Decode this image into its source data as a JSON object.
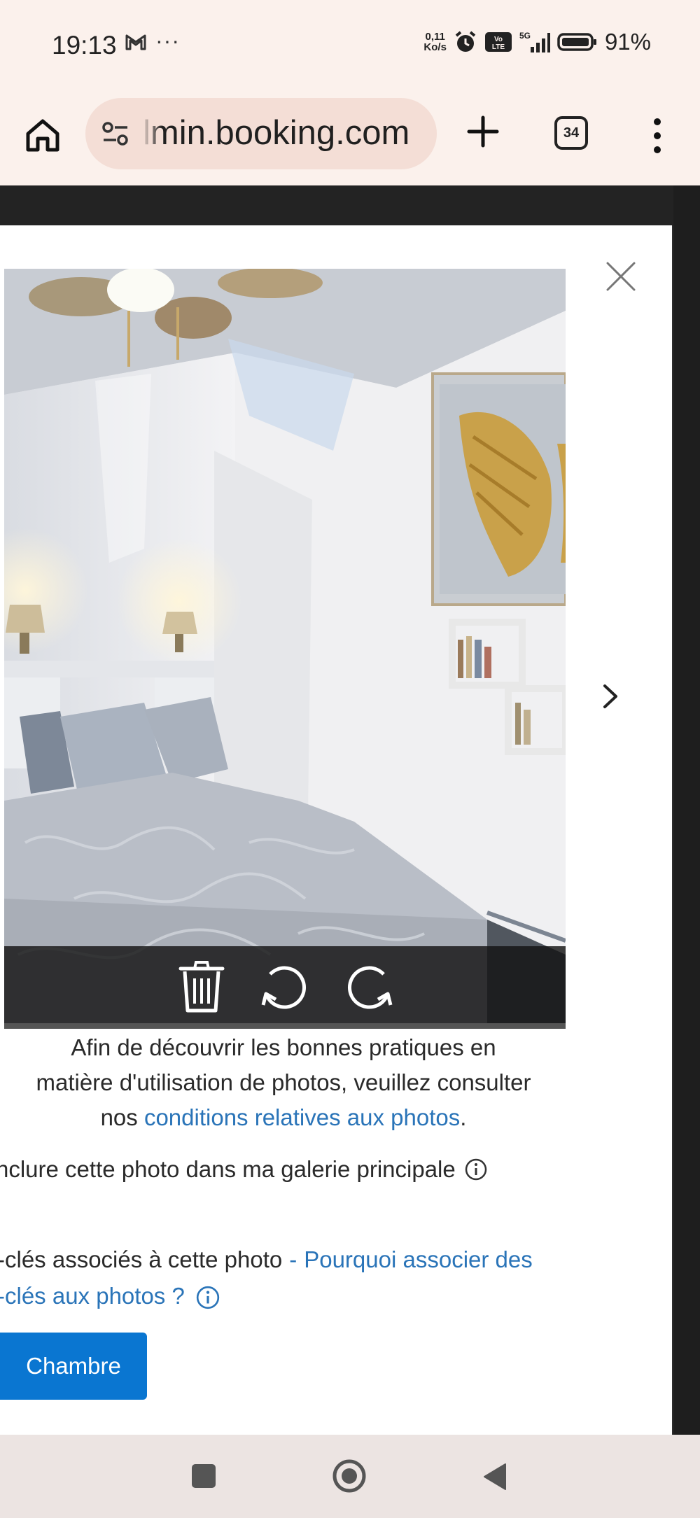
{
  "status_bar": {
    "time": "19:13",
    "more": "···",
    "net_speed_value": "0,11",
    "net_speed_unit": "Ko/s",
    "signal_label": "5G",
    "battery": "91%"
  },
  "browser": {
    "url": "lmin.booking.com",
    "tab_count": "34"
  },
  "modal": {
    "info_line1": "Afin de découvrir les bonnes pratiques en",
    "info_line2": "matière d'utilisation de photos, veuillez consulter",
    "info_line3_prefix": "nos ",
    "info_link": "conditions relatives aux photos",
    "info_line3_suffix": ".",
    "include_label": "nclure cette photo dans ma galerie principale",
    "keywords_label": "-clés associés à cette photo",
    "keywords_sep": "-",
    "why_link_line1": "Pourquoi associer des",
    "why_link_line2": "-clés aux photos ?",
    "tag_chip": "Chambre"
  }
}
